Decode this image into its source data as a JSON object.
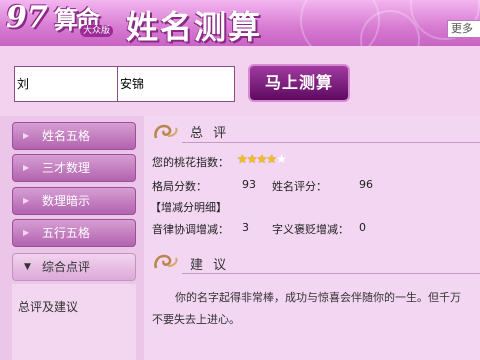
{
  "header": {
    "logo_97": "97",
    "logo_suanming": "算命",
    "logo_sub": "大众版",
    "title": "姓名测算",
    "more_label": "更多"
  },
  "form": {
    "surname_value": "刘",
    "givenname_value": "安锦",
    "submit_label": "马上测算"
  },
  "sidebar": {
    "items": [
      {
        "label": "姓名五格"
      },
      {
        "label": "三才数理"
      },
      {
        "label": "数理暗示"
      },
      {
        "label": "五行五格"
      },
      {
        "label": "综合点评"
      }
    ],
    "link": "总评及建议"
  },
  "summary": {
    "title": "总 评",
    "peach_label": "您的桃花指数：",
    "peach_rating": 4,
    "peach_max": 5,
    "pattern_label": "格局分数：",
    "pattern_value": "93",
    "name_label": "姓名评分：",
    "name_value": "96",
    "bonus_title": "【增减分明细】",
    "sound_label": "音律协调增减：",
    "sound_value": "3",
    "meaning_label": "字义褒贬增减：",
    "meaning_value": "0"
  },
  "advice": {
    "title": "建 议",
    "line1": "你的名字起得非常棒，成功与惊喜会伴随你的一生。但千万",
    "line2": "不要失去上进心。"
  },
  "colors": {
    "accent": "#7a1f7a",
    "header": "#d77ad2",
    "sidebar_item": "#c27dbe",
    "star": "#f2c019"
  }
}
